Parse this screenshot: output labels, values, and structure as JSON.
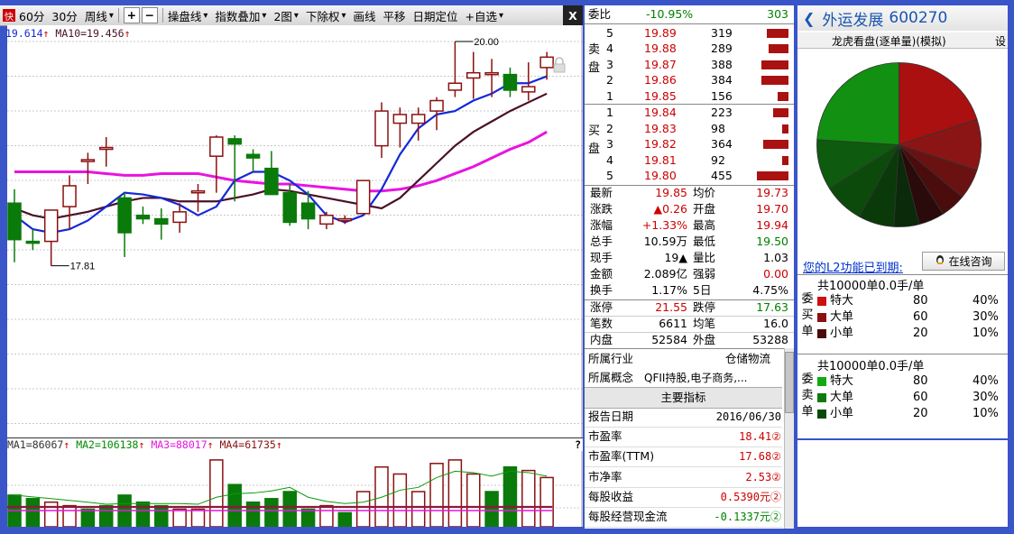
{
  "toolbar": {
    "items": [
      "60分",
      "30分",
      "周线",
      "操盘线",
      "指数叠加",
      "2图",
      "下除权",
      "画线",
      "平移",
      "日期定位",
      "+自选"
    ],
    "icon": "快",
    "plus": "+",
    "minus": "−",
    "close": "X"
  },
  "ma_legend": {
    "ma5": "19.614",
    "ma10": "MA10=19.456"
  },
  "price_high_label": "20.00",
  "price_low_label": "17.81",
  "vol_legend": {
    "ma1": "MA1=86067",
    "ma2": "MA2=106138",
    "ma3": "MA3=88017",
    "ma4": "MA4=61735",
    "q": "?"
  },
  "colors": {
    "up": "#8b1010",
    "down": "#0a7a0a",
    "ma5": "#1428d8",
    "ma10": "#4a1028",
    "ma20": "#e814e0"
  },
  "chart_data": {
    "type": "candlestick",
    "ylim": [
      17.81,
      20.0
    ],
    "candles": [
      {
        "o": 19.07,
        "h": 19.15,
        "l": 18.73,
        "c": 18.86
      },
      {
        "o": 18.85,
        "h": 18.92,
        "l": 18.8,
        "c": 18.84
      },
      {
        "o": 18.85,
        "h": 19.03,
        "l": 18.71,
        "c": 19.03
      },
      {
        "o": 19.05,
        "h": 19.23,
        "l": 18.92,
        "c": 19.17
      },
      {
        "o": 19.32,
        "h": 19.36,
        "l": 19.18,
        "c": 19.32
      },
      {
        "o": 19.39,
        "h": 19.45,
        "l": 19.28,
        "c": 19.39
      },
      {
        "o": 19.1,
        "h": 19.13,
        "l": 18.76,
        "c": 18.9
      },
      {
        "o": 19.0,
        "h": 19.05,
        "l": 18.95,
        "c": 18.98
      },
      {
        "o": 18.98,
        "h": 19.04,
        "l": 18.86,
        "c": 18.95
      },
      {
        "o": 18.96,
        "h": 19.07,
        "l": 18.9,
        "c": 19.02
      },
      {
        "o": 19.14,
        "h": 19.18,
        "l": 19.02,
        "c": 19.14
      },
      {
        "o": 19.34,
        "h": 19.46,
        "l": 19.13,
        "c": 19.45
      },
      {
        "o": 19.44,
        "h": 19.46,
        "l": 19.08,
        "c": 19.41
      },
      {
        "o": 19.35,
        "h": 19.38,
        "l": 19.25,
        "c": 19.33
      },
      {
        "o": 19.27,
        "h": 19.37,
        "l": 19.13,
        "c": 19.12
      },
      {
        "o": 19.13,
        "h": 19.18,
        "l": 18.94,
        "c": 18.96
      },
      {
        "o": 19.07,
        "h": 19.14,
        "l": 18.92,
        "c": 18.98
      },
      {
        "o": 18.95,
        "h": 19.02,
        "l": 18.92,
        "c": 19.0
      },
      {
        "o": 18.98,
        "h": 19.0,
        "l": 18.95,
        "c": 18.98
      },
      {
        "o": 19.01,
        "h": 19.15,
        "l": 19.01,
        "c": 19.2
      },
      {
        "o": 19.4,
        "h": 19.65,
        "l": 19.33,
        "c": 19.6
      },
      {
        "o": 19.53,
        "h": 19.62,
        "l": 19.39,
        "c": 19.58
      },
      {
        "o": 19.53,
        "h": 19.62,
        "l": 19.43,
        "c": 19.58
      },
      {
        "o": 19.6,
        "h": 19.68,
        "l": 19.49,
        "c": 19.66
      },
      {
        "o": 19.72,
        "h": 20.0,
        "l": 19.68,
        "c": 19.76
      },
      {
        "o": 19.79,
        "h": 19.94,
        "l": 19.67,
        "c": 19.82
      },
      {
        "o": 19.81,
        "h": 19.9,
        "l": 19.68,
        "c": 19.82
      },
      {
        "o": 19.81,
        "h": 19.85,
        "l": 19.68,
        "c": 19.72
      },
      {
        "o": 19.71,
        "h": 19.88,
        "l": 19.66,
        "c": 19.74
      },
      {
        "o": 19.85,
        "h": 19.94,
        "l": 19.78,
        "c": 19.91
      }
    ],
    "ma5": [
      19.0,
      18.92,
      18.9,
      18.92,
      18.97,
      19.05,
      19.13,
      19.12,
      19.1,
      19.06,
      19.0,
      19.05,
      19.2,
      19.25,
      19.25,
      19.2,
      19.12,
      19.0,
      18.96,
      19.0,
      19.15,
      19.35,
      19.5,
      19.58,
      19.6,
      19.66,
      19.7,
      19.76,
      19.76,
      19.8
    ],
    "ma10": [
      19.04,
      19.0,
      18.98,
      19.0,
      19.02,
      19.05,
      19.08,
      19.1,
      19.1,
      19.08,
      19.08,
      19.08,
      19.1,
      19.12,
      19.15,
      19.14,
      19.12,
      19.1,
      19.08,
      19.06,
      19.04,
      19.1,
      19.2,
      19.3,
      19.4,
      19.48,
      19.54,
      19.6,
      19.65,
      19.7
    ],
    "ma20": [
      19.25,
      19.25,
      19.25,
      19.25,
      19.25,
      19.24,
      19.23,
      19.23,
      19.24,
      19.24,
      19.24,
      19.22,
      19.2,
      19.19,
      19.18,
      19.18,
      19.17,
      19.16,
      19.15,
      19.14,
      19.14,
      19.15,
      19.17,
      19.2,
      19.24,
      19.28,
      19.33,
      19.38,
      19.42,
      19.48
    ],
    "volume": [
      {
        "v": 0.45,
        "up": false
      },
      {
        "v": 0.4,
        "up": false
      },
      {
        "v": 0.35,
        "up": true
      },
      {
        "v": 0.3,
        "up": true
      },
      {
        "v": 0.25,
        "up": false
      },
      {
        "v": 0.3,
        "up": false
      },
      {
        "v": 0.45,
        "up": false
      },
      {
        "v": 0.35,
        "up": false
      },
      {
        "v": 0.3,
        "up": false
      },
      {
        "v": 0.25,
        "up": true
      },
      {
        "v": 0.25,
        "up": true
      },
      {
        "v": 0.95,
        "up": true
      },
      {
        "v": 0.6,
        "up": false
      },
      {
        "v": 0.35,
        "up": false
      },
      {
        "v": 0.4,
        "up": false
      },
      {
        "v": 0.5,
        "up": false
      },
      {
        "v": 0.25,
        "up": false
      },
      {
        "v": 0.3,
        "up": true
      },
      {
        "v": 0.2,
        "up": false
      },
      {
        "v": 0.5,
        "up": true
      },
      {
        "v": 0.85,
        "up": true
      },
      {
        "v": 0.75,
        "up": true
      },
      {
        "v": 0.5,
        "up": true
      },
      {
        "v": 0.9,
        "up": true
      },
      {
        "v": 0.95,
        "up": true
      },
      {
        "v": 0.75,
        "up": true
      },
      {
        "v": 0.5,
        "up": false
      },
      {
        "v": 0.85,
        "up": false
      },
      {
        "v": 0.8,
        "up": true
      },
      {
        "v": 0.7,
        "up": true
      }
    ]
  },
  "book": {
    "weibi": {
      "label": "委比",
      "pct": "-10.95%",
      "val": "303"
    },
    "sell_label": "卖盘",
    "buy_label": "买盘",
    "sell": [
      {
        "n": "5",
        "p": "19.89",
        "v": "319",
        "w": 0.27
      },
      {
        "n": "4",
        "p": "19.88",
        "v": "289",
        "w": 0.24
      },
      {
        "n": "3",
        "p": "19.87",
        "v": "388",
        "w": 0.33
      },
      {
        "n": "2",
        "p": "19.86",
        "v": "384",
        "w": 0.33
      },
      {
        "n": "1",
        "p": "19.85",
        "v": "156",
        "w": 0.13
      }
    ],
    "buy": [
      {
        "n": "1",
        "p": "19.84",
        "v": "223",
        "w": 0.19
      },
      {
        "n": "2",
        "p": "19.83",
        "v": "98",
        "w": 0.08
      },
      {
        "n": "3",
        "p": "19.82",
        "v": "364",
        "w": 0.31
      },
      {
        "n": "4",
        "p": "19.81",
        "v": "92",
        "w": 0.08
      },
      {
        "n": "5",
        "p": "19.80",
        "v": "455",
        "w": 0.39
      }
    ],
    "stats": [
      {
        "l1": "最新",
        "v1": "19.85",
        "c1": "red",
        "l2": "均价",
        "v2": "19.73",
        "c2": "red"
      },
      {
        "l1": "涨跌",
        "v1": "▲0.26",
        "c1": "red",
        "l2": "开盘",
        "v2": "19.70",
        "c2": "red"
      },
      {
        "l1": "涨幅",
        "v1": "+1.33%",
        "c1": "red",
        "l2": "最高",
        "v2": "19.94",
        "c2": "red"
      },
      {
        "l1": "总手",
        "v1": "10.59万",
        "c1": "blk",
        "l2": "最低",
        "v2": "19.50",
        "c2": "green"
      },
      {
        "l1": "现手",
        "v1": "19▲",
        "c1": "blk",
        "l2": "量比",
        "v2": "1.03",
        "c2": "blk"
      },
      {
        "l1": "金额",
        "v1": "2.089亿",
        "c1": "blk",
        "l2": "强弱",
        "v2": "0.00",
        "c2": "red"
      },
      {
        "l1": "换手",
        "v1": "1.17%",
        "c1": "blk",
        "l2": "5日",
        "v2": "4.75%",
        "c2": "blk"
      }
    ],
    "limits": [
      {
        "l1": "涨停",
        "v1": "21.55",
        "c1": "red",
        "l2": "跌停",
        "v2": "17.63",
        "c2": "green"
      },
      {
        "l1": "笔数",
        "v1": "6611",
        "c1": "blk",
        "l2": "均笔",
        "v2": "16.0",
        "c2": "blk"
      },
      {
        "l1": "内盘",
        "v1": "52584",
        "c1": "blk",
        "l2": "外盘",
        "v2": "53288",
        "c2": "blk"
      }
    ],
    "industry_label": "所属行业",
    "industry": "仓储物流",
    "concept_label": "所属概念",
    "concept": "QFII持股,电子商务,...",
    "indicators_title": "主要指标",
    "indicators": [
      {
        "l": "报告日期",
        "v": "2016/06/30",
        "c": "blk"
      },
      {
        "l": "市盈率",
        "v": "18.41②",
        "c": "red"
      },
      {
        "l": "市盈率(TTM)",
        "v": "17.68②",
        "c": "red"
      },
      {
        "l": "市净率",
        "v": "2.53②",
        "c": "red"
      },
      {
        "l": "每股收益",
        "v": "0.5390元②",
        "c": "red"
      },
      {
        "l": "每股经营现金流",
        "v": "-0.1337元②",
        "c": "green"
      }
    ]
  },
  "right": {
    "back_arrow": "❮",
    "stock_name": "外运发展",
    "stock_code": "600270",
    "subtitle": "龙虎看盘(逐单量)(模拟)",
    "subtitle_right": "设",
    "pie": [
      {
        "w": 0.2,
        "color": "#aa1010"
      },
      {
        "w": 0.1,
        "color": "#8b1515"
      },
      {
        "w": 0.06,
        "color": "#6a1212"
      },
      {
        "w": 0.05,
        "color": "#4a0c0c"
      },
      {
        "w": 0.05,
        "color": "#2a0a0a"
      },
      {
        "w": 0.05,
        "color": "#0a2a0a"
      },
      {
        "w": 0.07,
        "color": "#0a3a0a"
      },
      {
        "w": 0.08,
        "color": "#0c4a0c"
      },
      {
        "w": 0.1,
        "color": "#0e5a0e"
      },
      {
        "w": 0.24,
        "color": "#119011"
      }
    ],
    "l2_text": "您的L2功能已到期:",
    "consult": "在线咨询",
    "buy_group": {
      "header": "共10000单0.0手/单",
      "side": "委买单",
      "items": [
        {
          "label": "特大",
          "n": "80",
          "pct": "40%",
          "color": "#cc1010"
        },
        {
          "label": "大单",
          "n": "60",
          "pct": "30%",
          "color": "#8b1010"
        },
        {
          "label": "小单",
          "n": "20",
          "pct": "10%",
          "color": "#4a0a0a"
        }
      ]
    },
    "sell_group": {
      "header": "共10000单0.0手/单",
      "side": "委卖单",
      "items": [
        {
          "label": "特大",
          "n": "80",
          "pct": "40%",
          "color": "#11aa11"
        },
        {
          "label": "大单",
          "n": "60",
          "pct": "30%",
          "color": "#0c7a0c"
        },
        {
          "label": "小单",
          "n": "20",
          "pct": "10%",
          "color": "#064a06"
        }
      ]
    }
  }
}
